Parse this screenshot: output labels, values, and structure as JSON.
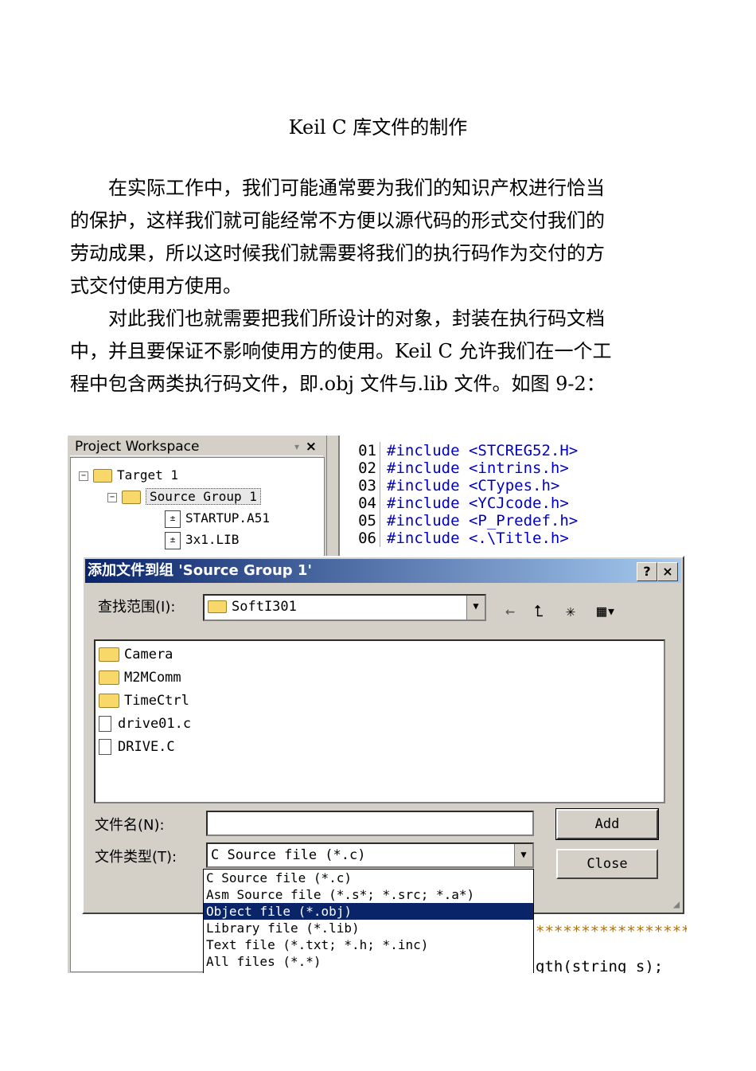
{
  "document": {
    "title": "Keil C 库文件的制作",
    "paragraph1": [
      "在实际工作中，我们可能通常要为我们的知识产权进行恰当",
      "的保护，这样我们就可能经常不方便以源代码的形式交付我们的",
      "劳动成果，所以这时候我们就需要将我们的执行码作为交付的方",
      "式交付使用方使用。"
    ],
    "paragraph2": [
      "对此我们也就需要把我们所设计的对象，封装在执行码文档",
      "中，并且要保证不影响使用方的使用。Keil C 允许我们在一个工",
      "程中包含两类执行码文件，即.obj 文件与.lib 文件。如图 9-2："
    ]
  },
  "workspace": {
    "title": "Project Workspace",
    "pin_glyph": "▾",
    "close_glyph": "×",
    "tree": [
      {
        "label": "Target 1"
      },
      {
        "label": "Source Group 1"
      },
      {
        "label": "STARTUP.A51"
      },
      {
        "label": "3x1.LIB"
      }
    ]
  },
  "editor": {
    "lines": [
      {
        "num": "01",
        "code": "#include <STCREG52.H>"
      },
      {
        "num": "02",
        "code": "#include <intrins.h>"
      },
      {
        "num": "03",
        "code": "#include <CTypes.h>"
      },
      {
        "num": "04",
        "code": "#include <YCJcode.h>"
      },
      {
        "num": "05",
        "code": "#include <P_Predef.h>"
      },
      {
        "num": "06",
        "code": "#include <.\\Title.h>"
      }
    ],
    "peek_lines": [
      "*****************",
      "gth(string s);"
    ]
  },
  "dialog": {
    "title": "添加文件到组 'Source Group 1'",
    "help_glyph": "?",
    "close_glyph": "×",
    "look_in_label": "查找范围(I):",
    "look_in_value": "SoftI301",
    "files": [
      {
        "name": "Camera",
        "type": "folder"
      },
      {
        "name": "M2MComm",
        "type": "folder"
      },
      {
        "name": "TimeCtrl",
        "type": "folder"
      },
      {
        "name": "drive01.c",
        "type": "file"
      },
      {
        "name": "DRIVE.C",
        "type": "file"
      }
    ],
    "filename_label": "文件名(N):",
    "filename_value": "",
    "filetype_label": "文件类型(T):",
    "filetype_value": "C Source file (*.c)",
    "add_button": "Add",
    "close_button": "Close",
    "filetype_options": [
      "C Source file (*.c)",
      "Asm Source file (*.s*; *.src; *.a*)",
      "Object file (*.obj)",
      "Library file (*.lib)",
      "Text file (*.txt; *.h; *.inc)",
      "All files (*.*)"
    ],
    "highlighted_option_index": 2,
    "accent_color": "#0a246a"
  }
}
